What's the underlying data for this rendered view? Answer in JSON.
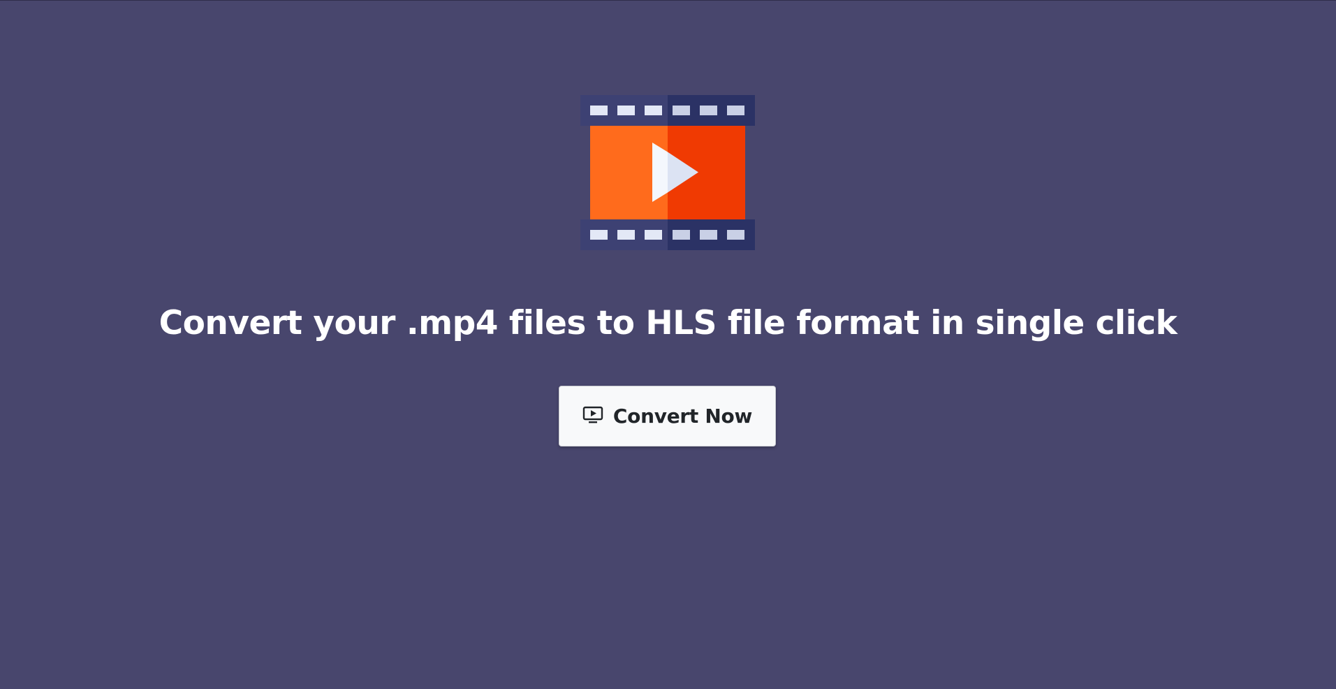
{
  "hero": {
    "icon": "film-play-icon",
    "headline": "Convert your .mp4 files to HLS file format in single click"
  },
  "actions": {
    "convert_button": {
      "label": "Convert Now",
      "icon": "monitor-play-icon"
    }
  },
  "colors": {
    "background": "#48466d",
    "film_strip_left": "#3d4173",
    "film_strip_right": "#2b3265",
    "film_frame_left": "#ff6b1c",
    "film_frame_right": "#f03a02",
    "button_background": "#f8f9fa",
    "text_primary": "#ffffff"
  }
}
